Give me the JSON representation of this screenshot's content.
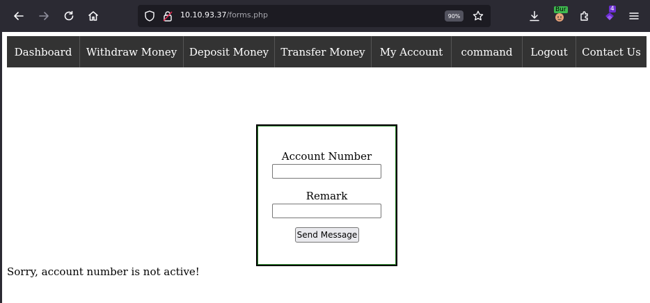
{
  "browser": {
    "url_host": "10.10.93.37",
    "url_path": "/forms.php",
    "zoom": "90%",
    "extensions": {
      "burp_label": "Bur",
      "badge_count": "4"
    },
    "icons": [
      "back-icon",
      "forward-icon",
      "reload-icon",
      "home-icon",
      "shield-icon",
      "lock-icon",
      "star-icon",
      "download-icon",
      "burp-extension-icon",
      "extensions-icon",
      "addon-icon",
      "menu-icon"
    ]
  },
  "nav": {
    "items": [
      {
        "label": "Dashboard"
      },
      {
        "label": "Withdraw Money"
      },
      {
        "label": "Deposit Money"
      },
      {
        "label": "Transfer Money"
      },
      {
        "label": "My Account"
      },
      {
        "label": "command"
      },
      {
        "label": "Logout"
      },
      {
        "label": "Contact Us"
      }
    ]
  },
  "form": {
    "account_label": "Account Number",
    "account_value": "",
    "remark_label": "Remark",
    "remark_value": "",
    "submit_label": "Send Message"
  },
  "message": "Sorry, account number is not active!",
  "colors": {
    "toolbar_bg": "#2b2a33",
    "nav_bg": "#333333",
    "form_border_accent": "#2e8b2e"
  }
}
